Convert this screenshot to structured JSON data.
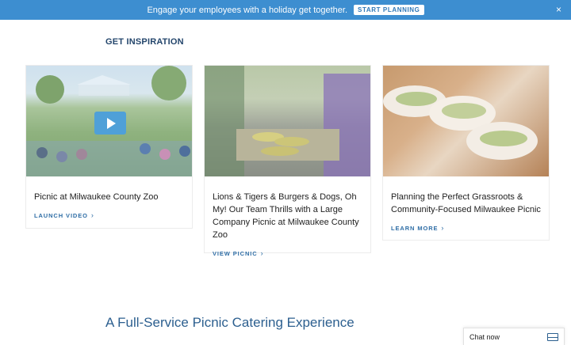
{
  "promo": {
    "message": "Engage your employees with a holiday get together.",
    "cta_label": "START PLANNING",
    "close_label": "×"
  },
  "inspiration": {
    "heading": "GET INSPIRATION",
    "cards": [
      {
        "title": "Picnic at Milwaukee County Zoo",
        "link_label": "LAUNCH VIDEO",
        "image": "crowd-at-park-picnic-video"
      },
      {
        "title": "Lions & Tigers & Burgers & Dogs, Oh My! Our Team Thrills with a Large Company Picnic at Milwaukee County Zoo",
        "link_label": "VIEW PICNIC",
        "image": "corn-on-the-cob-buffet"
      },
      {
        "title": "Planning the Perfect Grassroots & Community-Focused Milwaukee Picnic",
        "link_label": "LEARN MORE",
        "image": "tacos-on-table"
      }
    ]
  },
  "catering": {
    "heading": "A Full-Service Picnic Catering Experience"
  },
  "chat": {
    "label": "Chat now",
    "icon": "chat-window-icon"
  },
  "colors": {
    "promo_bar": "#3d8ed0",
    "heading": "#24466c",
    "link": "#2f6ea6"
  }
}
